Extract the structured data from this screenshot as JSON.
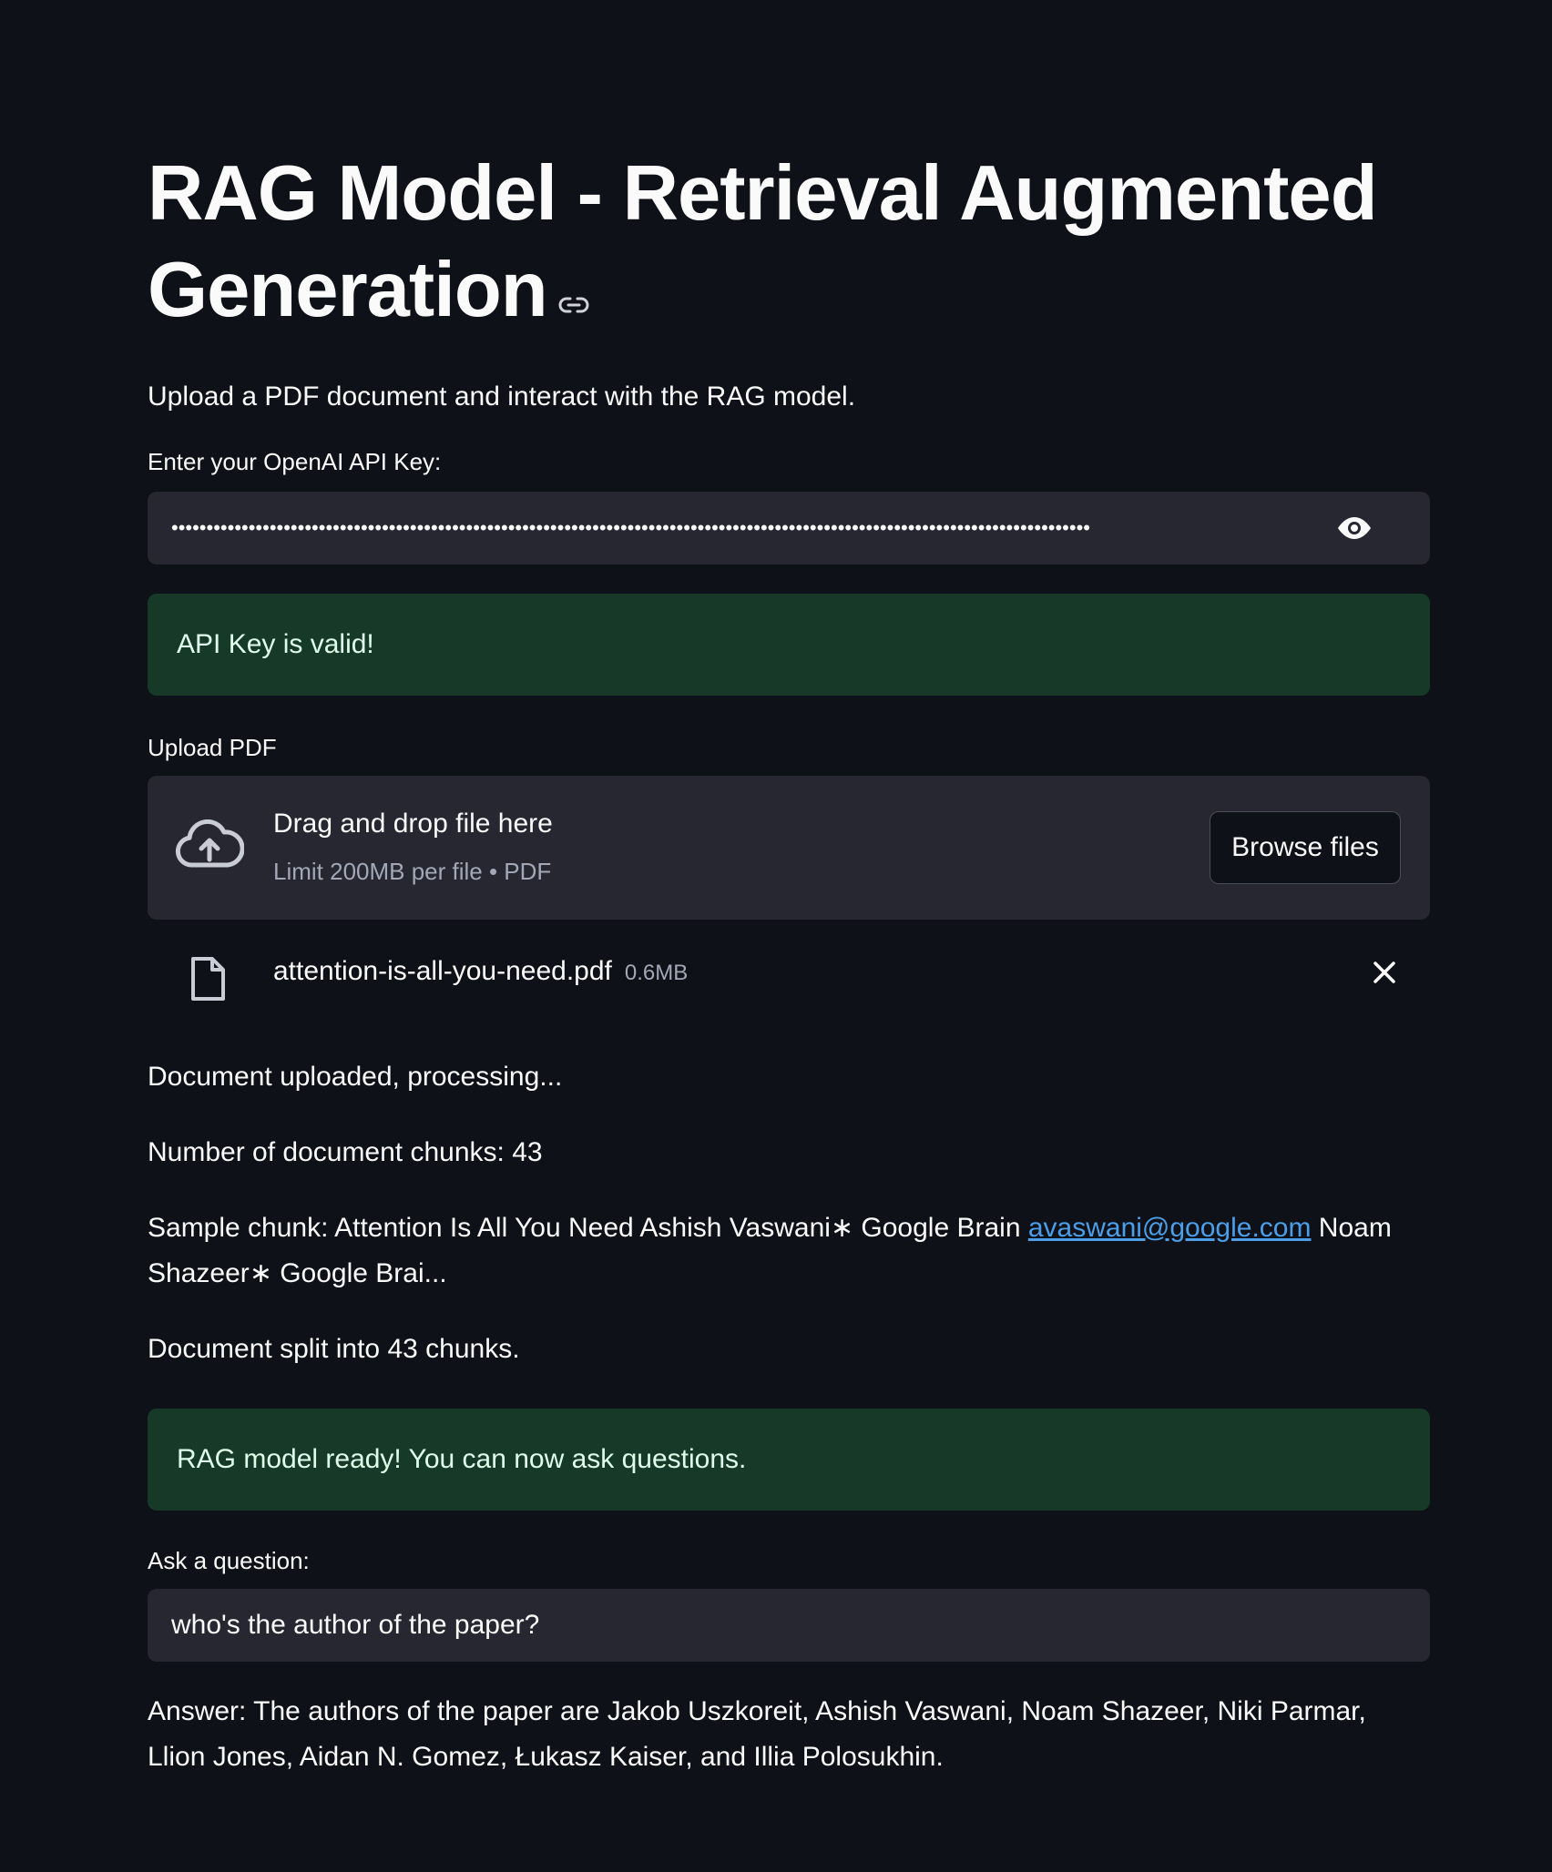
{
  "header": {
    "title": "RAG Model - Retrieval Augmented Generation",
    "subtitle": "Upload a PDF document and interact with the RAG model."
  },
  "api_key": {
    "label": "Enter your OpenAI API Key:",
    "masked_value": "•••••••••••••••••••••••••••••••••••••••••••••••••••••••••••••••••••••••••••••••••••••••••••••••••••••••••••••••••••••••••••••••••••",
    "toggle_icon": "eye-icon"
  },
  "api_status": {
    "message": "API Key is valid!"
  },
  "upload": {
    "label": "Upload PDF",
    "drop_text": "Drag and drop file here",
    "limit_text": "Limit 200MB per file • PDF",
    "browse_label": "Browse files",
    "file": {
      "name": "attention-is-all-you-need.pdf",
      "size": "0.6MB"
    }
  },
  "log": {
    "processing": "Document uploaded, processing...",
    "chunks": "Number of document chunks: 43",
    "sample_prefix": "Sample chunk: Attention Is All You Need Ashish Vaswani∗ Google Brain ",
    "sample_email": "avaswani@google.com",
    "sample_suffix": " Noam Shazeer∗ Google Brai...",
    "split": "Document split into 43 chunks."
  },
  "ready_status": {
    "message": "RAG model ready! You can now ask questions."
  },
  "question": {
    "label": "Ask a question:",
    "value": "who's the author of the paper?"
  },
  "answer": {
    "text": "Answer: The authors of the paper are Jakob Uszkoreit, Ashish Vaswani, Noam Shazeer, Niki Parmar, Llion Jones, Aidan N. Gomez, Łukasz Kaiser, and Illia Polosukhin."
  },
  "colors": {
    "background": "#0e1117",
    "input_bg": "#262730",
    "success_bg": "#173928",
    "success_text": "#dffde9",
    "link": "#4c9ee8"
  }
}
